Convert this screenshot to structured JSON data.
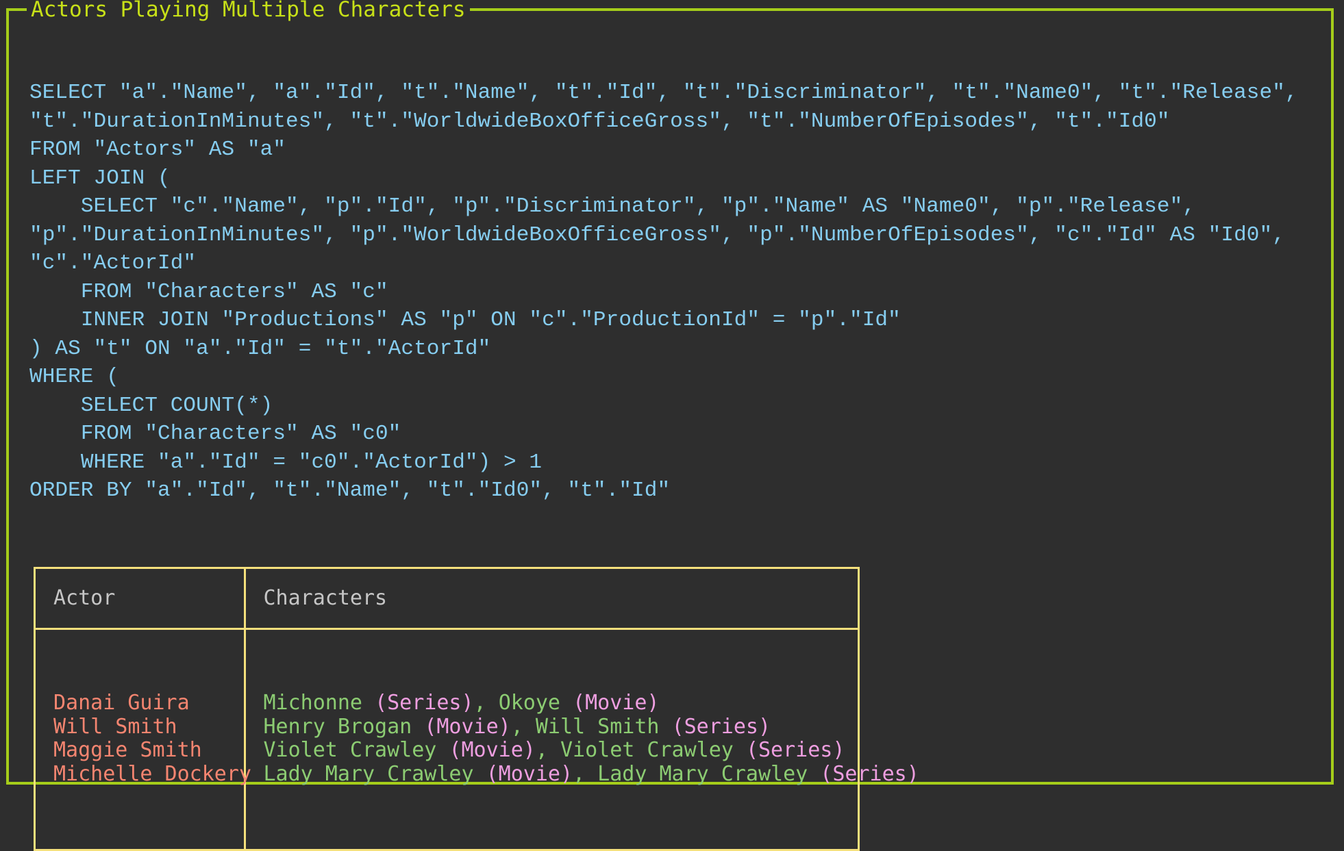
{
  "panel": {
    "title": "Actors Playing Multiple Characters",
    "border_color": "#a5cd1a",
    "title_color": "#c7e018",
    "background": "#2e2e2e"
  },
  "sql": {
    "color": "#86cdf0",
    "text": "SELECT \"a\".\"Name\", \"a\".\"Id\", \"t\".\"Name\", \"t\".\"Id\", \"t\".\"Discriminator\", \"t\".\"Name0\", \"t\".\"Release\", \"t\".\"DurationInMinutes\", \"t\".\"WorldwideBoxOfficeGross\", \"t\".\"NumberOfEpisodes\", \"t\".\"Id0\"\nFROM \"Actors\" AS \"a\"\nLEFT JOIN (\n    SELECT \"c\".\"Name\", \"p\".\"Id\", \"p\".\"Discriminator\", \"p\".\"Name\" AS \"Name0\", \"p\".\"Release\", \"p\".\"DurationInMinutes\", \"p\".\"WorldwideBoxOfficeGross\", \"p\".\"NumberOfEpisodes\", \"c\".\"Id\" AS \"Id0\", \"c\".\"ActorId\"\n    FROM \"Characters\" AS \"c\"\n    INNER JOIN \"Productions\" AS \"p\" ON \"c\".\"ProductionId\" = \"p\".\"Id\"\n) AS \"t\" ON \"a\".\"Id\" = \"t\".\"ActorId\"\nWHERE (\n    SELECT COUNT(*)\n    FROM \"Characters\" AS \"c0\"\n    WHERE \"a\".\"Id\" = \"c0\".\"ActorId\") > 1\nORDER BY \"a\".\"Id\", \"t\".\"Name\", \"t\".\"Id0\", \"t\".\"Id\""
  },
  "results_table": {
    "border_color": "#f5e07c",
    "header_color": "#c6c6c6",
    "actor_color": "#f58570",
    "character_color": "#8ccc72",
    "kind_color": "#ee9ee0",
    "columns": [
      "Actor",
      "Characters"
    ],
    "actors": [
      "Danai Guira",
      "Will Smith",
      "Maggie Smith",
      "Michelle Dockery"
    ],
    "characters": [
      [
        {
          "name": "Michonne",
          "kind": "(Series)",
          "sep": ", "
        },
        {
          "name": "Okoye",
          "kind": "(Movie)",
          "sep": ""
        }
      ],
      [
        {
          "name": "Henry Brogan",
          "kind": "(Movie)",
          "sep": ", "
        },
        {
          "name": "Will Smith",
          "kind": "(Series)",
          "sep": ""
        }
      ],
      [
        {
          "name": "Violet Crawley",
          "kind": "(Movie)",
          "sep": ", "
        },
        {
          "name": "Violet Crawley",
          "kind": "(Series)",
          "sep": ""
        }
      ],
      [
        {
          "name": "Lady Mary Crawley",
          "kind": "(Movie)",
          "sep": ", "
        },
        {
          "name": "Lady Mary Crawley",
          "kind": "(Series)",
          "sep": ""
        }
      ]
    ]
  }
}
